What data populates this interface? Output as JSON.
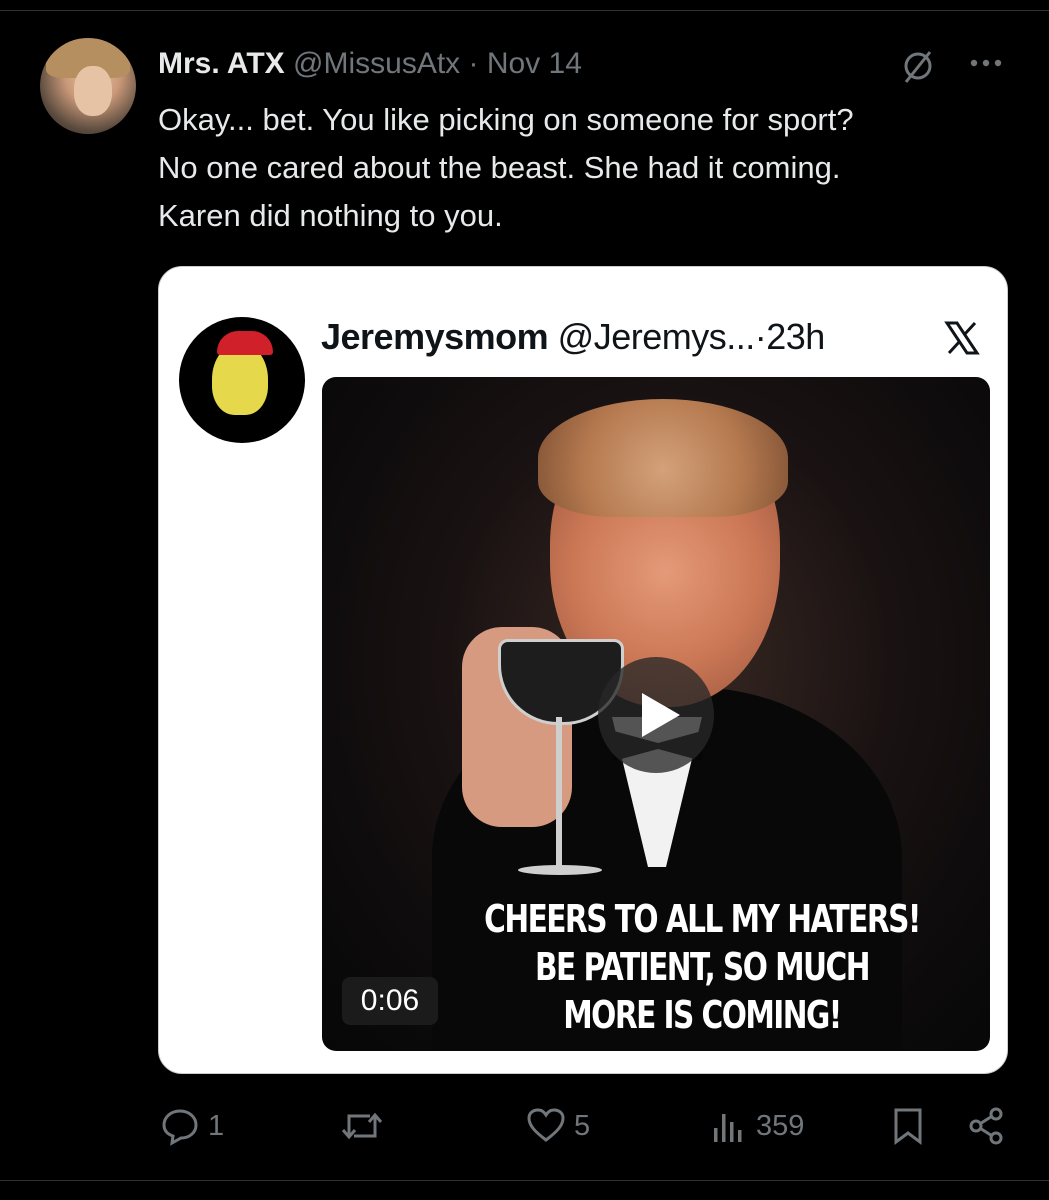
{
  "tweet": {
    "author_name": "Mrs. ATX",
    "author_handle": "@MissusAtx",
    "separator": " · ",
    "date": "Nov 14",
    "text_lines": [
      "Okay... bet. You like picking on someone for sport?",
      "No one cared about the beast. She had it coming.",
      "Karen did nothing to you."
    ]
  },
  "quoted": {
    "author_name": "Jeremysmom",
    "author_handle": "@Jeremys...",
    "time": "·23h",
    "caption_lines": [
      "CHEERS TO ALL MY HATERS!",
      "BE PATIENT, SO MUCH",
      "MORE IS COMING!"
    ],
    "duration": "0:06"
  },
  "actions": {
    "replies": "1",
    "retweets": "",
    "likes": "5",
    "views": "359"
  },
  "icons": [
    "grok-icon",
    "more-icon",
    "x-logo-icon",
    "play-icon",
    "reply-icon",
    "retweet-icon",
    "like-icon",
    "views-icon",
    "bookmark-icon",
    "share-icon"
  ],
  "colors": {
    "background": "#000000",
    "text": "#e7e9ea",
    "muted": "#71767b",
    "card": "#ffffff"
  }
}
